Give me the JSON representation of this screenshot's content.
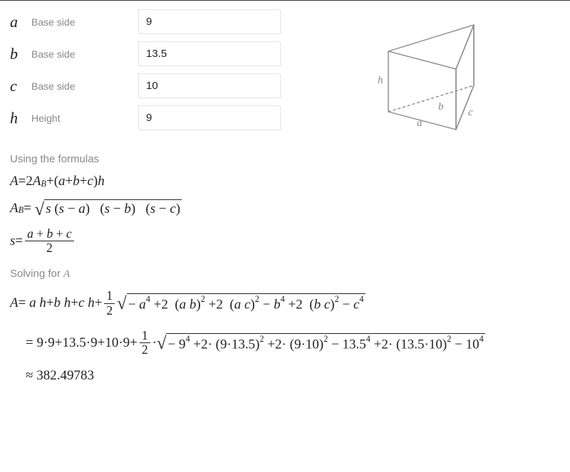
{
  "inputs": {
    "a": {
      "symbol": "a",
      "label": "Base side",
      "value": "9"
    },
    "b": {
      "symbol": "b",
      "label": "Base side",
      "value": "13.5"
    },
    "c": {
      "symbol": "c",
      "label": "Base side",
      "value": "10"
    },
    "h": {
      "symbol": "h",
      "label": "Height",
      "value": "9"
    }
  },
  "diagram": {
    "h": "h",
    "a": "a",
    "b": "b",
    "c": "c"
  },
  "labels": {
    "usingFormulas": "Using the formulas",
    "solvingFor": "Solving for ",
    "solvingForVar": "A"
  },
  "formulas": {
    "f1": {
      "lhs_var": "A",
      "eq": "=",
      "two": "2",
      "sp": " ",
      "AB_A": "A",
      "AB_B": "B",
      "plus": "+",
      "lp": "(",
      "a": "a",
      "b": "b",
      "c": "c",
      "rp": ")",
      "h": "h"
    },
    "f2": {
      "AB_A": "A",
      "AB_B": "B",
      "eq": "=",
      "s": "s",
      "lp": "(",
      "a": "a",
      "b": "b",
      "c": "c",
      "rp": ")",
      "minus": " − "
    },
    "f3": {
      "s": "s",
      "eq": "=",
      "a": "a",
      "plus": "+",
      "b": "b",
      "c": "c",
      "two": "2"
    }
  },
  "solve": {
    "line1": {
      "A": "A",
      "eq": "=",
      "a": "a",
      "h": "h",
      "b": "b",
      "c": "c",
      "plus": "+",
      "one": "1",
      "two": "2",
      "neg": " − ",
      "pos": "+",
      "sp": " ",
      "p4": "4",
      "p2": "2",
      "t2": "2",
      "lp": "(",
      "rp": ")"
    },
    "line2": {
      "eq": "=",
      "dot": "·",
      "plus": "+",
      "n9": "9",
      "n135": "13.5",
      "n10": "10",
      "one": "1",
      "two": "2",
      "neg": " − ",
      "t2": "2",
      "lp": "(",
      "rp": ")",
      "p4": "4",
      "p2": "2"
    },
    "line3": {
      "approx": "≈",
      "val": "382.49783"
    }
  }
}
